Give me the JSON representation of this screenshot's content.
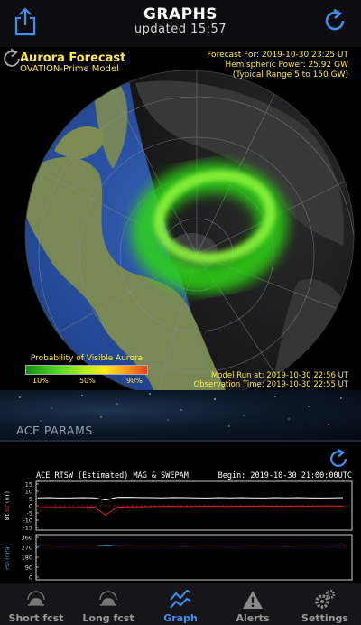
{
  "header": {
    "title": "GRAPHS",
    "subtitle": "updated  15:57"
  },
  "map": {
    "title": "Aurora Forecast",
    "model": "OVATION-Prime Model",
    "forecast_for": "Forecast For: 2019-10-30 23:25 UT",
    "hemispheric_power": "Hemispheric Power: 25.92 GW",
    "typical_range": "(Typical Range 5 to 150 GW)",
    "legend_title": "Probability of Visible Aurora",
    "legend_ticks": [
      "10%",
      "50%",
      "90%"
    ],
    "model_run": "Model Run at: 2019-10-30 22:56 UT",
    "observation_time": "Observation Time: 2019-10-30 22:55 UT"
  },
  "section": {
    "label": "ACE PARAMS"
  },
  "ace_chart": {
    "title": "ACE RTSW (Estimated) MAG & SWEPAM",
    "begin": "Begin: 2019-10-30 21:00:00UTC",
    "panel1_ylabel": "Bt Bz (nT)",
    "panel1_ticks": [
      "15",
      "10",
      "5",
      "0",
      "-5",
      "-10",
      "-15"
    ],
    "panel2_ylabel": "PD (nPa)",
    "panel2_ticks": [
      "360",
      "270",
      "180",
      "90",
      "0"
    ]
  },
  "chart_data": {
    "type": "line",
    "title": "ACE RTSW (Estimated) MAG & SWEPAM",
    "panels": [
      {
        "ylabel": "Bt Bz (nT)",
        "ylim": [
          -15,
          15
        ],
        "series": [
          {
            "values": [
              5.5,
              5.6,
              5.4,
              5.5,
              5.6,
              5.5,
              4.0,
              5.8,
              5.9,
              5.7,
              5.6,
              5.5,
              5.7,
              5.6,
              5.5,
              5.4,
              5.6,
              5.5,
              5.6,
              5.5,
              5.4,
              5.6,
              5.5,
              5.6,
              5.5,
              5.4,
              5.5,
              5.6
            ]
          },
          {
            "values": [
              -1.5,
              -1.2,
              -1.0,
              -1.3,
              -1.1,
              -0.9,
              -6.5,
              -1.0,
              -0.8,
              -0.7,
              -0.6,
              -0.5,
              -0.4,
              -0.6,
              -0.5,
              -0.3,
              -0.4,
              -0.5,
              -0.3,
              -0.4,
              -0.2,
              -0.3,
              -0.4,
              -0.2,
              -0.3,
              -0.1,
              -0.2,
              -0.3
            ]
          }
        ]
      },
      {
        "ylabel": "PD (nPa)",
        "ylim": [
          0,
          360
        ],
        "series": [
          {
            "values": [
              283,
              283,
              281,
              282,
              283,
              282,
              290,
              284,
              283,
              282,
              282,
              283,
              282,
              281,
              282,
              283,
              282,
              281,
              282,
              283,
              282,
              282,
              281,
              282,
              283,
              282,
              281,
              282
            ]
          }
        ]
      }
    ]
  },
  "tabs": [
    {
      "label": "Short fcst",
      "icon": "aurora-dome-icon"
    },
    {
      "label": "Long fcst",
      "icon": "aurora-dome-icon"
    },
    {
      "label": "Graph",
      "icon": "graph-icon",
      "active": true
    },
    {
      "label": "Alerts",
      "icon": "alert-triangle-icon"
    },
    {
      "label": "Settings",
      "icon": "gears-icon"
    }
  ],
  "colors": {
    "accent": "#3d8ff1",
    "map_text": "#ffe94a",
    "bt_line": "#ffffff",
    "bz_line": "#e02020",
    "pd_line": "#3aa0d8"
  }
}
